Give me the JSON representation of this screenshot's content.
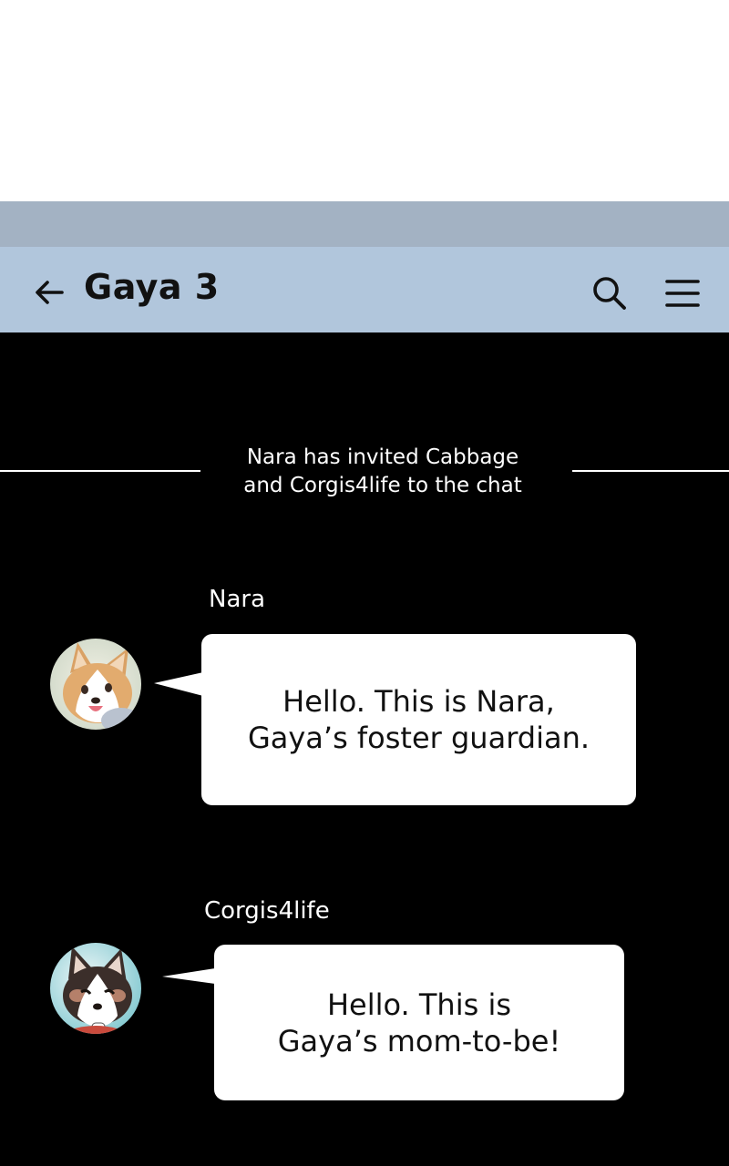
{
  "header": {
    "title": "Gaya 3",
    "back_icon": "arrow-left-icon",
    "search_icon": "search-icon",
    "menu_icon": "menu-icon"
  },
  "system_message": "Nara has invited Cabbage\nand Corgis4life to the chat",
  "messages": [
    {
      "sender": "Nara",
      "avatar": "corgi-avatar-tan",
      "text": "Hello. This is Nara,\nGaya’s foster guardian."
    },
    {
      "sender": "Corgis4life",
      "avatar": "corgi-avatar-tricolor",
      "text": "Hello. This is\nGaya’s mom-to-be!"
    }
  ],
  "colors": {
    "header_bg": "#b1c6dc",
    "status_strip_bg": "#a3b2c3",
    "chat_bg": "#000000",
    "bubble_bg": "#ffffff"
  }
}
